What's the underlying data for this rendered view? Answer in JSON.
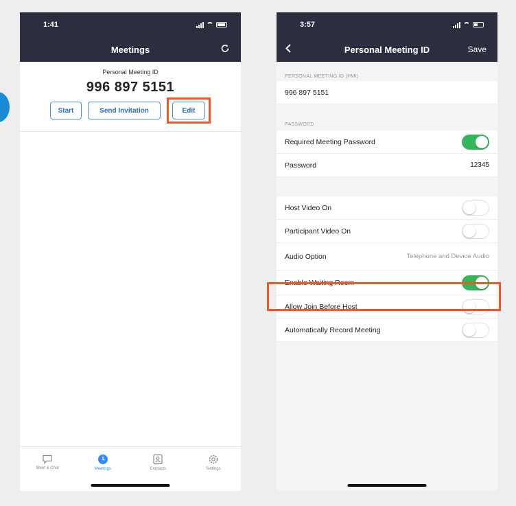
{
  "left": {
    "status_time": "1:41",
    "nav_title": "Meetings",
    "pmi_label": "Personal Meeting ID",
    "pmi_number": "996 897 5151",
    "buttons": {
      "start": "Start",
      "send_invitation": "Send Invitation",
      "edit": "Edit"
    },
    "tabs": [
      {
        "label": "Meet & Chat",
        "icon": "chat-bubble-icon"
      },
      {
        "label": "Meetings",
        "icon": "clock-icon"
      },
      {
        "label": "Contacts",
        "icon": "contact-card-icon"
      },
      {
        "label": "Settings",
        "icon": "gear-icon"
      }
    ],
    "active_tab": 1
  },
  "right": {
    "status_time": "3:57",
    "nav_title": "Personal Meeting ID",
    "nav_save": "Save",
    "sections": {
      "pmi_label": "PERSONAL MEETING ID (PMI)",
      "pmi_value": "996 897 5151",
      "password_label": "PASSWORD"
    },
    "password_rows": {
      "required_label": "Required Meeting Password",
      "required_on": true,
      "password_label": "Password",
      "password_value": "12345"
    },
    "options": {
      "host_video": "Host Video On",
      "host_video_on": false,
      "participant_video": "Participant Video On",
      "participant_video_on": false,
      "audio_option": "Audio Option",
      "audio_value": "Telephone and Device Audio",
      "waiting_room": "Enable Waiting Room",
      "waiting_room_on": true,
      "join_before_host": "Allow Join Before Host",
      "join_before_host_on": false,
      "auto_record": "Automatically Record Meeting",
      "auto_record_on": false
    }
  },
  "colors": {
    "header": "#2c2d3e",
    "accent_blue": "#2d8cff",
    "toggle_on": "#34b75a",
    "highlight": "#f05a22"
  }
}
